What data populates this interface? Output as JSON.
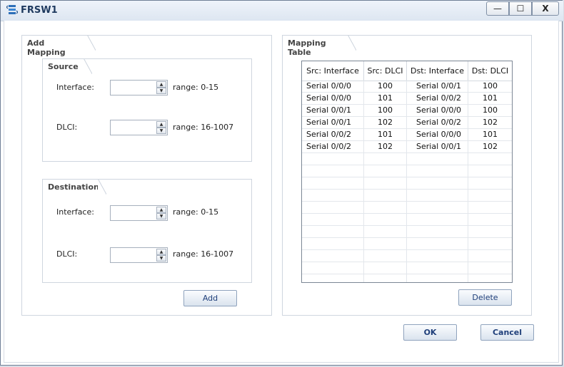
{
  "window": {
    "title": "FRSW1",
    "minimize_label": "—",
    "maximize_label": "☐",
    "close_label": "X"
  },
  "add_mapping": {
    "title": "Add Mapping",
    "source": {
      "title": "Source",
      "interface": {
        "label": "Interface:",
        "value": "",
        "range": "range: 0-15"
      },
      "dlci": {
        "label": "DLCI:",
        "value": "",
        "range": "range: 16-1007"
      }
    },
    "destination": {
      "title": "Destination",
      "interface": {
        "label": "Interface:",
        "value": "",
        "range": "range: 0-15"
      },
      "dlci": {
        "label": "DLCI:",
        "value": "",
        "range": "range: 16-1007"
      }
    },
    "add_label": "Add"
  },
  "mapping_table": {
    "title": "Mapping Table",
    "columns": [
      "Src: Interface",
      "Src: DLCI",
      "Dst: Interface",
      "Dst: DLCI"
    ],
    "rows": [
      [
        "Serial 0/0/0",
        "100",
        "Serial 0/0/1",
        "100"
      ],
      [
        "Serial 0/0/0",
        "101",
        "Serial 0/0/2",
        "101"
      ],
      [
        "Serial 0/0/1",
        "100",
        "Serial 0/0/0",
        "100"
      ],
      [
        "Serial 0/0/1",
        "102",
        "Serial 0/0/2",
        "102"
      ],
      [
        "Serial 0/0/2",
        "101",
        "Serial 0/0/0",
        "101"
      ],
      [
        "Serial 0/0/2",
        "102",
        "Serial 0/0/1",
        "102"
      ]
    ],
    "delete_label": "Delete"
  },
  "footer": {
    "ok_label": "OK",
    "cancel_label": "Cancel"
  },
  "colors": {
    "accent": "#1f3f7a",
    "border": "#cfd6df"
  }
}
